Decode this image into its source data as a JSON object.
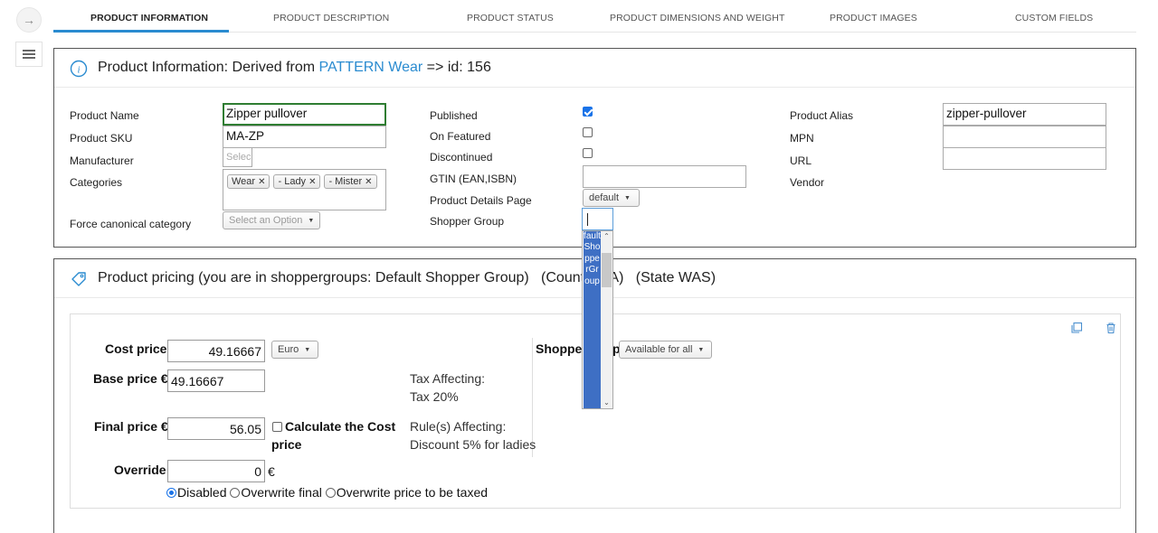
{
  "tabs": [
    {
      "label": "PRODUCT INFORMATION",
      "active": true
    },
    {
      "label": "PRODUCT DESCRIPTION"
    },
    {
      "label": "PRODUCT STATUS"
    },
    {
      "label": "PRODUCT DIMENSIONS AND WEIGHT"
    },
    {
      "label": "PRODUCT IMAGES"
    },
    {
      "label": "CUSTOM FIELDS"
    }
  ],
  "info": {
    "title_prefix": "Product Information: Derived from ",
    "parent_link": "PATTERN Wear",
    "title_suffix": " => id: 156",
    "product_name_label": "Product Name",
    "product_name_value": "Zipper pullover",
    "product_sku_label": "Product SKU",
    "product_sku_value": "MA-ZP",
    "manufacturer_label": "Manufacturer",
    "manufacturer_placeholder": "Selec",
    "categories_label": "Categories",
    "categories": [
      "Wear",
      "- Lady",
      "- Mister"
    ],
    "force_canonical_label": "Force canonical category",
    "force_canonical_placeholder": "Select an Option",
    "published_label": "Published",
    "published_checked": true,
    "on_featured_label": "On Featured",
    "on_featured_checked": false,
    "discontinued_label": "Discontinued",
    "discontinued_checked": false,
    "gtin_label": "GTIN (EAN,ISBN)",
    "gtin_value": "",
    "details_page_label": "Product Details Page",
    "details_page_value": "default",
    "shopper_group_label": "Shopper Group",
    "product_alias_label": "Product Alias",
    "product_alias_value": "zipper-pullover",
    "mpn_label": "MPN",
    "url_label": "URL",
    "vendor_label": "Vendor"
  },
  "shopper_group_dropdown": {
    "option": "faultShopperGroup"
  },
  "pricing": {
    "title": "Product pricing (you are in shoppergroups: Default Shopper Group)   (Country",
    "title_tail": "A)   (State WAS)",
    "cost_price_label": "Cost price",
    "cost_price_value": "49.16667",
    "currency_value": "Euro",
    "base_price_label": "Base price €",
    "base_price_value": "49.16667",
    "final_price_label": "Final price €",
    "final_price_value": "56.05",
    "calc_cost_label_1": "Calculate the Cost",
    "calc_cost_label_2": "price",
    "override_label": "Override",
    "override_value": "0",
    "override_unit": "€",
    "tax_affecting_label": "Tax Affecting:",
    "tax_affecting_value": "Tax 20%",
    "rules_affecting_label": "Rule(s) Affecting:",
    "rules_affecting_value": "Discount 5% for ladies",
    "radio_options": [
      "Disabled",
      "Overwrite final",
      "Overwrite price to be taxed"
    ],
    "radio_selected": 0,
    "shopper_label_left": "Shopper",
    "shopper_label_right": "p",
    "shopper_select_value": "Available for all"
  },
  "colors": {
    "accent": "#2a8bd0",
    "focus_border": "#2f7d32",
    "dropdown_selected": "#3e6fc4"
  }
}
